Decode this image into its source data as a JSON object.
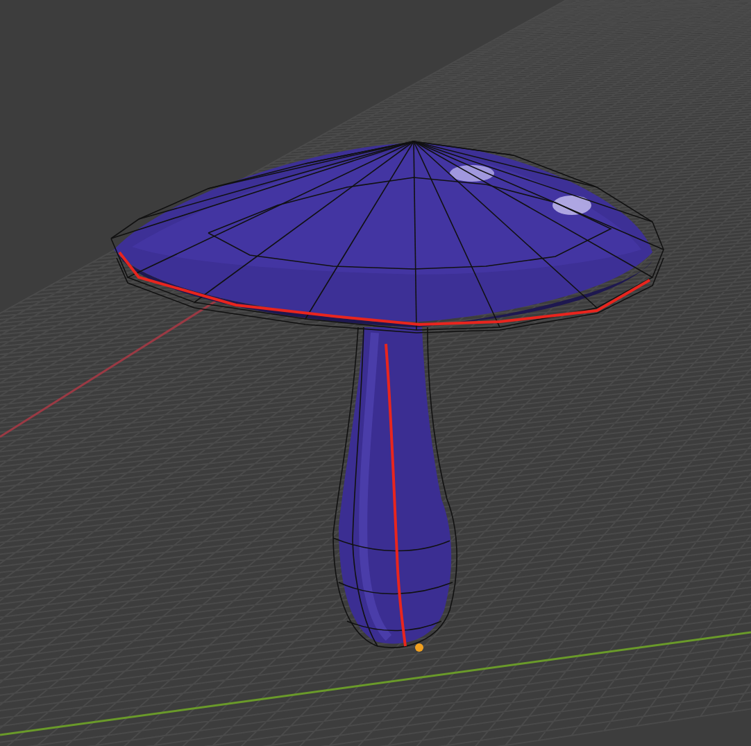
{
  "viewport": {
    "show_x_axis": true,
    "show_y_axis": true,
    "show_wireframe": true,
    "show_selected_edges": true
  }
}
